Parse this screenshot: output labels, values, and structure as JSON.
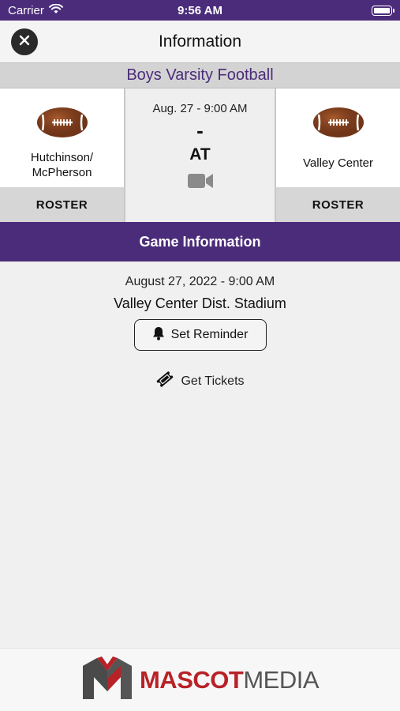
{
  "status_bar": {
    "carrier": "Carrier",
    "time": "9:56 AM"
  },
  "header": {
    "title": "Information"
  },
  "sport": {
    "name": "Boys Varsity Football"
  },
  "matchup": {
    "home_team": {
      "name": "Hutchinson/\nMcPherson",
      "roster_label": "ROSTER"
    },
    "away_team": {
      "name": "Valley Center",
      "roster_label": "ROSTER"
    },
    "game_datetime": "Aug. 27 - 9:00 AM",
    "score": "-",
    "at_label": "AT"
  },
  "game_information": {
    "section_title": "Game Information",
    "full_date": "August 27, 2022 - 9:00 AM",
    "venue": "Valley Center Dist. Stadium",
    "reminder_label": "Set Reminder",
    "tickets_label": "Get Tickets"
  },
  "footer": {
    "brand_mascot": "MASCOT",
    "brand_media": "MEDIA"
  },
  "colors": {
    "brand_purple": "#4b2c7a",
    "brand_red": "#b82227"
  },
  "icons": [
    "wifi-icon",
    "battery-icon",
    "close-icon",
    "football-icon",
    "video-camera-icon",
    "bell-icon",
    "ticket-icon",
    "mascot-media-logo"
  ]
}
